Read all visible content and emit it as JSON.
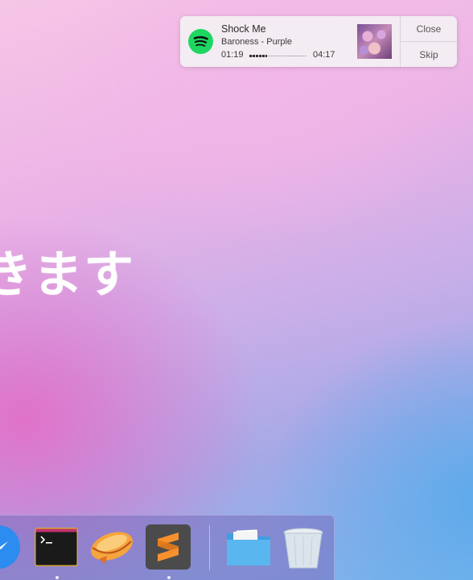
{
  "wallpaper": {
    "text": "きます"
  },
  "notification": {
    "app_icon": "spotify-icon",
    "title": "Shock Me",
    "subtitle": "Baroness - Purple",
    "elapsed": "01:19",
    "total": "04:17",
    "progress_fraction": 0.31,
    "album_art": "album-art-image",
    "actions": {
      "close": "Close",
      "skip": "Skip"
    }
  },
  "dock": {
    "items": [
      {
        "name": "messenger-icon",
        "running": false
      },
      {
        "name": "terminal-icon",
        "running": true
      },
      {
        "name": "airmail-icon",
        "running": false
      },
      {
        "name": "sublime-text-icon",
        "running": true
      },
      {
        "name": "folder-icon",
        "running": false
      },
      {
        "name": "trash-icon",
        "running": false
      }
    ]
  },
  "colors": {
    "spotify_green": "#1ed760",
    "sublime_orange": "#f6912e",
    "folder_blue": "#5ab6ee"
  }
}
